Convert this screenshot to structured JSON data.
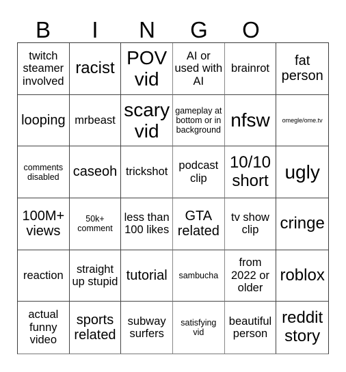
{
  "title_letters": [
    "B",
    "I",
    "N",
    "G",
    "O"
  ],
  "cells": [
    {
      "text": "twitch steamer involved",
      "size": "md"
    },
    {
      "text": "racist",
      "size": "xl"
    },
    {
      "text": "POV vid",
      "size": "xxl"
    },
    {
      "text": "AI or used with AI",
      "size": "md"
    },
    {
      "text": "brainrot",
      "size": "md"
    },
    {
      "text": "fat person",
      "size": "lg"
    },
    {
      "text": "looping",
      "size": "lg"
    },
    {
      "text": "mrbeast",
      "size": "md"
    },
    {
      "text": "scary vid",
      "size": "xxl"
    },
    {
      "text": "gameplay at bottom or in background",
      "size": "sm"
    },
    {
      "text": "nfsw",
      "size": "xxl"
    },
    {
      "text": "omegle/ome.tv",
      "size": "xs"
    },
    {
      "text": "comments disabled",
      "size": "sm"
    },
    {
      "text": "caseoh",
      "size": "lg"
    },
    {
      "text": "trickshot",
      "size": "md"
    },
    {
      "text": "podcast clip",
      "size": "md"
    },
    {
      "text": "10/10 short",
      "size": "xl"
    },
    {
      "text": "ugly",
      "size": "xxl"
    },
    {
      "text": "100M+ views",
      "size": "lg"
    },
    {
      "text": "50k+ comment",
      "size": "sm"
    },
    {
      "text": "less than 100 likes",
      "size": "md"
    },
    {
      "text": "GTA related",
      "size": "lg"
    },
    {
      "text": "tv show clip",
      "size": "md"
    },
    {
      "text": "cringe",
      "size": "xl"
    },
    {
      "text": "reaction",
      "size": "md"
    },
    {
      "text": "straight up stupid",
      "size": "md"
    },
    {
      "text": "tutorial",
      "size": "lg"
    },
    {
      "text": "sambucha",
      "size": "sm"
    },
    {
      "text": "from 2022 or older",
      "size": "md"
    },
    {
      "text": "roblox",
      "size": "xl"
    },
    {
      "text": "actual funny video",
      "size": "md"
    },
    {
      "text": "sports related",
      "size": "lg"
    },
    {
      "text": "subway surfers",
      "size": "md"
    },
    {
      "text": "satisfying vid",
      "size": "sm"
    },
    {
      "text": "beautiful person",
      "size": "md"
    },
    {
      "text": "reddit story",
      "size": "xl"
    }
  ]
}
